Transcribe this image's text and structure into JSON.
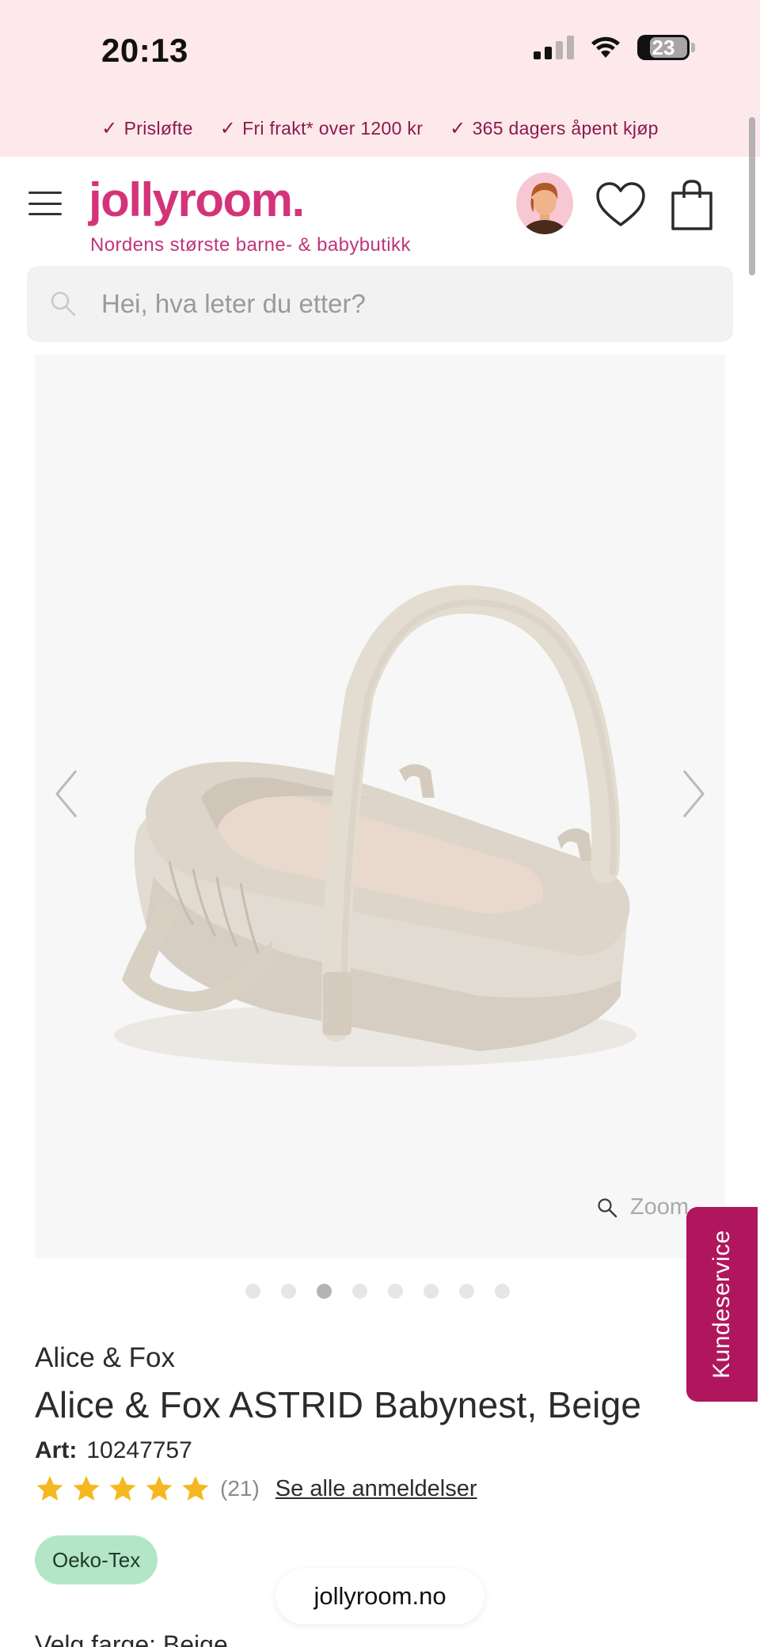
{
  "status_bar": {
    "time": "20:13",
    "battery": "23"
  },
  "promo": [
    {
      "label": "Prisløfte"
    },
    {
      "label": "Fri frakt* over 1200 kr"
    },
    {
      "label": "365 dagers åpent kjøp"
    }
  ],
  "header": {
    "logo": "jollyroom.",
    "tagline": "Nordens største barne- & babybutikk"
  },
  "search": {
    "placeholder": "Hei, hva leter du etter?"
  },
  "gallery": {
    "zoom_label": "Zoom",
    "slide_count": 8,
    "active_slide_index": 2
  },
  "customer_service": {
    "label": "Kundeservice"
  },
  "product": {
    "brand": "Alice & Fox",
    "title": "Alice & Fox ASTRID Babynest, Beige",
    "art_label": "Art:",
    "art_number": "10247757",
    "rating_stars": 5,
    "rating_count": "(21)",
    "reviews_link": "Se alle anmeldelser",
    "badge": "Oeko-Tex",
    "color_label": "Velg farge: Beige"
  },
  "browser": {
    "url": "jollyroom.no"
  },
  "colors": {
    "brand_pink": "#d4337a",
    "promo_bg": "#fde8ec",
    "promo_text": "#8a1a4a",
    "service_tab": "#b0165d",
    "star": "#f5b820",
    "badge_bg": "#b3e6c6"
  }
}
